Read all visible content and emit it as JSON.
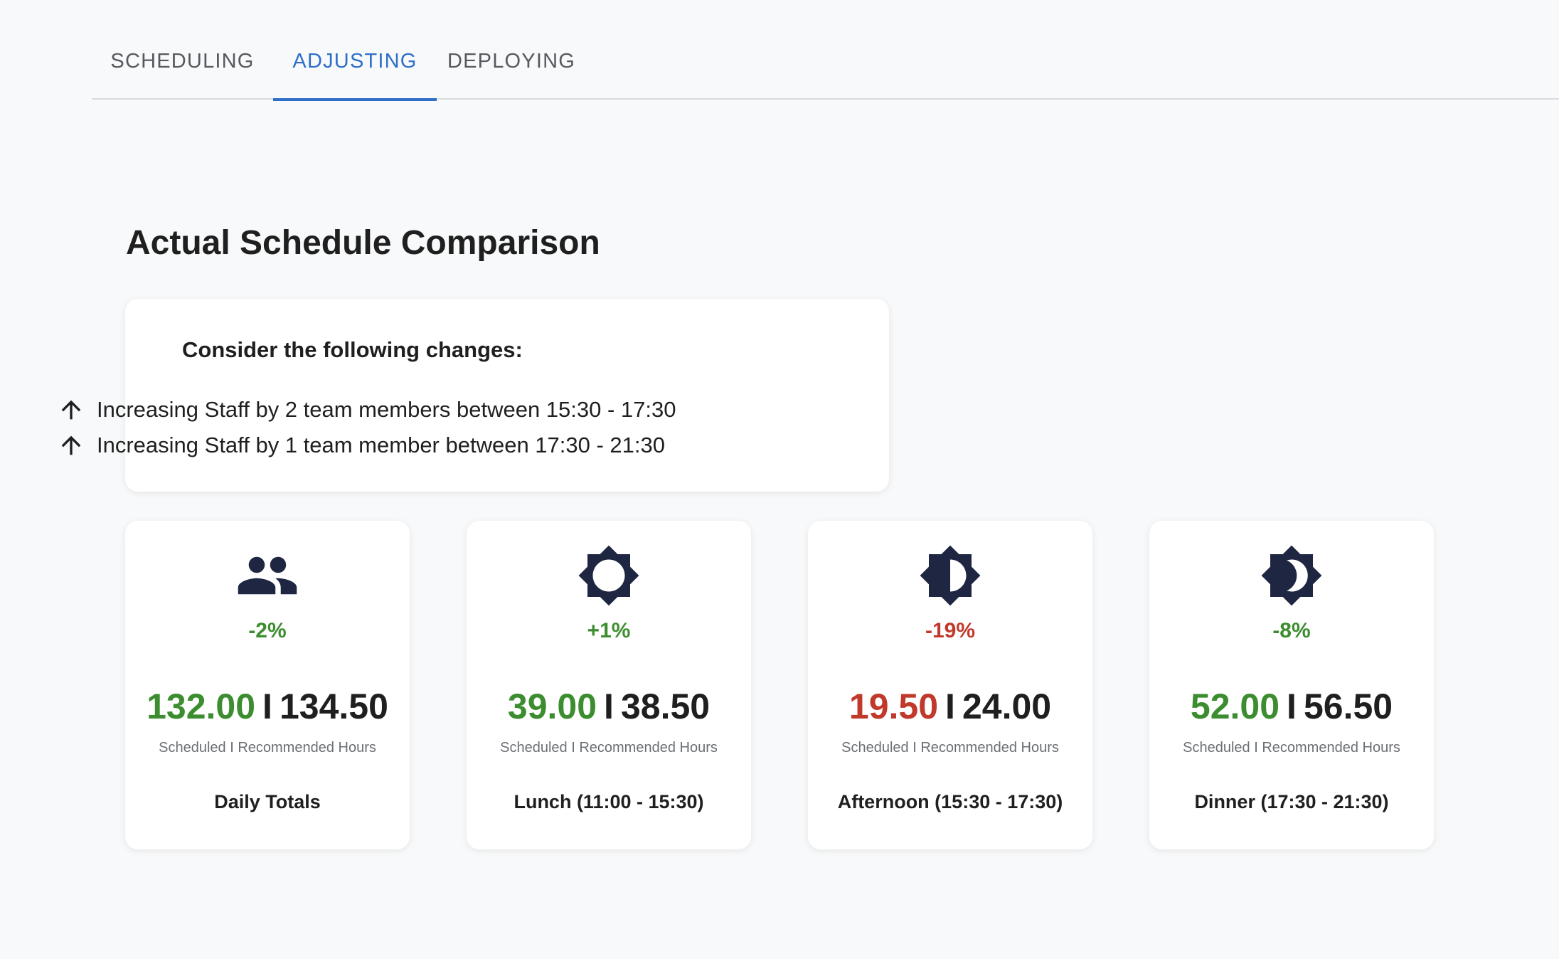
{
  "tabs": [
    {
      "label": "SCHEDULING",
      "active": false
    },
    {
      "label": "ADJUSTING",
      "active": true
    },
    {
      "label": "DEPLOYING",
      "active": false
    }
  ],
  "page": {
    "title": "Actual Schedule Comparison"
  },
  "suggestions": {
    "title": "Consider the following changes:",
    "items": [
      {
        "icon": "arrow-up-icon",
        "text": "Increasing Staff by 2 team members between 15:30 - 17:30"
      },
      {
        "icon": "arrow-up-icon",
        "text": "Increasing Staff by 1 team member between 17:30 - 21:30"
      }
    ]
  },
  "colors": {
    "accent": "#2f6fc9",
    "positive": "#3c8d2f",
    "negative": "#c0392b",
    "icon": "#1e2642"
  },
  "metrics": [
    {
      "icon": "people-icon",
      "change": "-2%",
      "change_status": "positive",
      "scheduled": "132.00",
      "scheduled_status": "positive",
      "separator": "I",
      "recommended": "134.50",
      "caption": "Scheduled I Recommended Hours",
      "label": "Daily Totals"
    },
    {
      "icon": "brightness-high-icon",
      "change": "+1%",
      "change_status": "positive",
      "scheduled": "39.00",
      "scheduled_status": "positive",
      "separator": "I",
      "recommended": "38.50",
      "caption": "Scheduled I Recommended Hours",
      "label": "Lunch (11:00 - 15:30)"
    },
    {
      "icon": "brightness-medium-icon",
      "change": "-19%",
      "change_status": "negative",
      "scheduled": "19.50",
      "scheduled_status": "negative",
      "separator": "I",
      "recommended": "24.00",
      "caption": "Scheduled I Recommended Hours",
      "label": "Afternoon (15:30 - 17:30)"
    },
    {
      "icon": "brightness-night-icon",
      "change": "-8%",
      "change_status": "positive",
      "scheduled": "52.00",
      "scheduled_status": "positive",
      "separator": "I",
      "recommended": "56.50",
      "caption": "Scheduled I Recommended Hours",
      "label": "Dinner (17:30 - 21:30)"
    }
  ]
}
